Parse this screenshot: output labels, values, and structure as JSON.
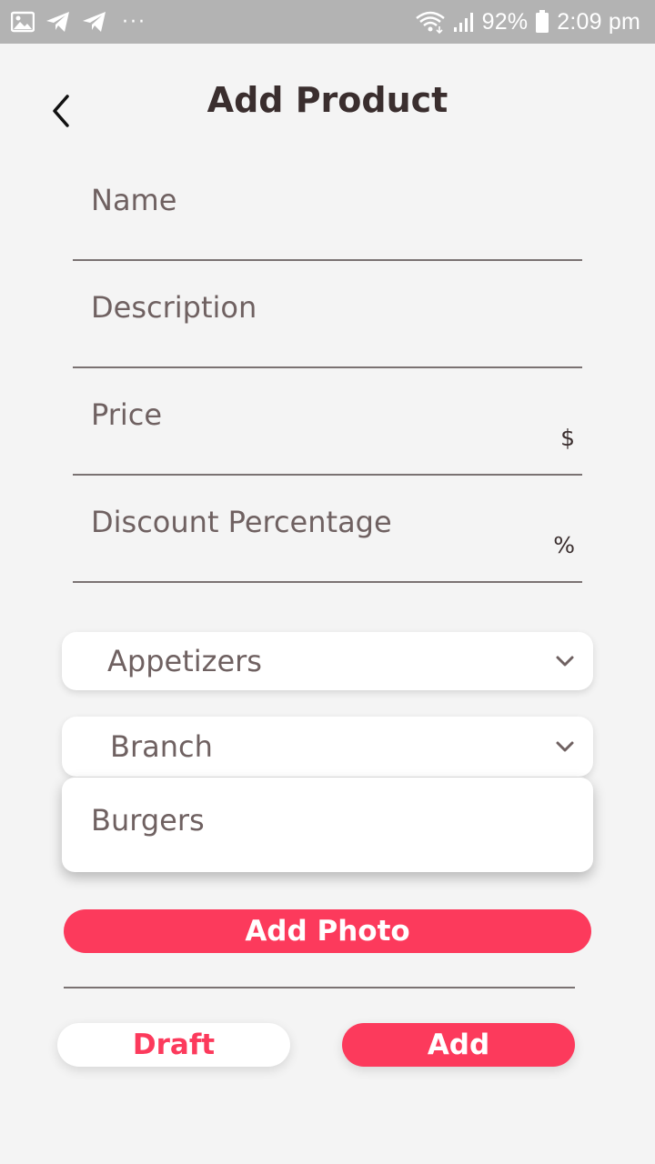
{
  "status_bar": {
    "battery_percent": "92%",
    "time": "2:09 pm",
    "dots": "···",
    "left_icons": [
      "gallery-icon",
      "telegram-icon",
      "telegram-icon"
    ],
    "right_icons": [
      "wifi-icon",
      "signal-icon",
      "battery-icon"
    ],
    "background": "#b3b3b3"
  },
  "header": {
    "title": "Add Product",
    "back_icon": "chevron-left-icon"
  },
  "form": {
    "name_label": "Name",
    "description_label": "Description",
    "price_label": "Price",
    "price_suffix": "$",
    "discount_label": "Discount Percentage",
    "discount_suffix": "%"
  },
  "dropdowns": {
    "category_value": "Appetizers",
    "branch_value": "Branch",
    "open_menu_options": [
      "Burgers"
    ]
  },
  "buttons": {
    "add_photo": "Add Photo",
    "draft": "Draft",
    "add": "Add"
  },
  "colors": {
    "accent": "#fc3a5c",
    "background": "#f4f4f4",
    "text": "#6f6161",
    "title": "#3a2e2e"
  }
}
